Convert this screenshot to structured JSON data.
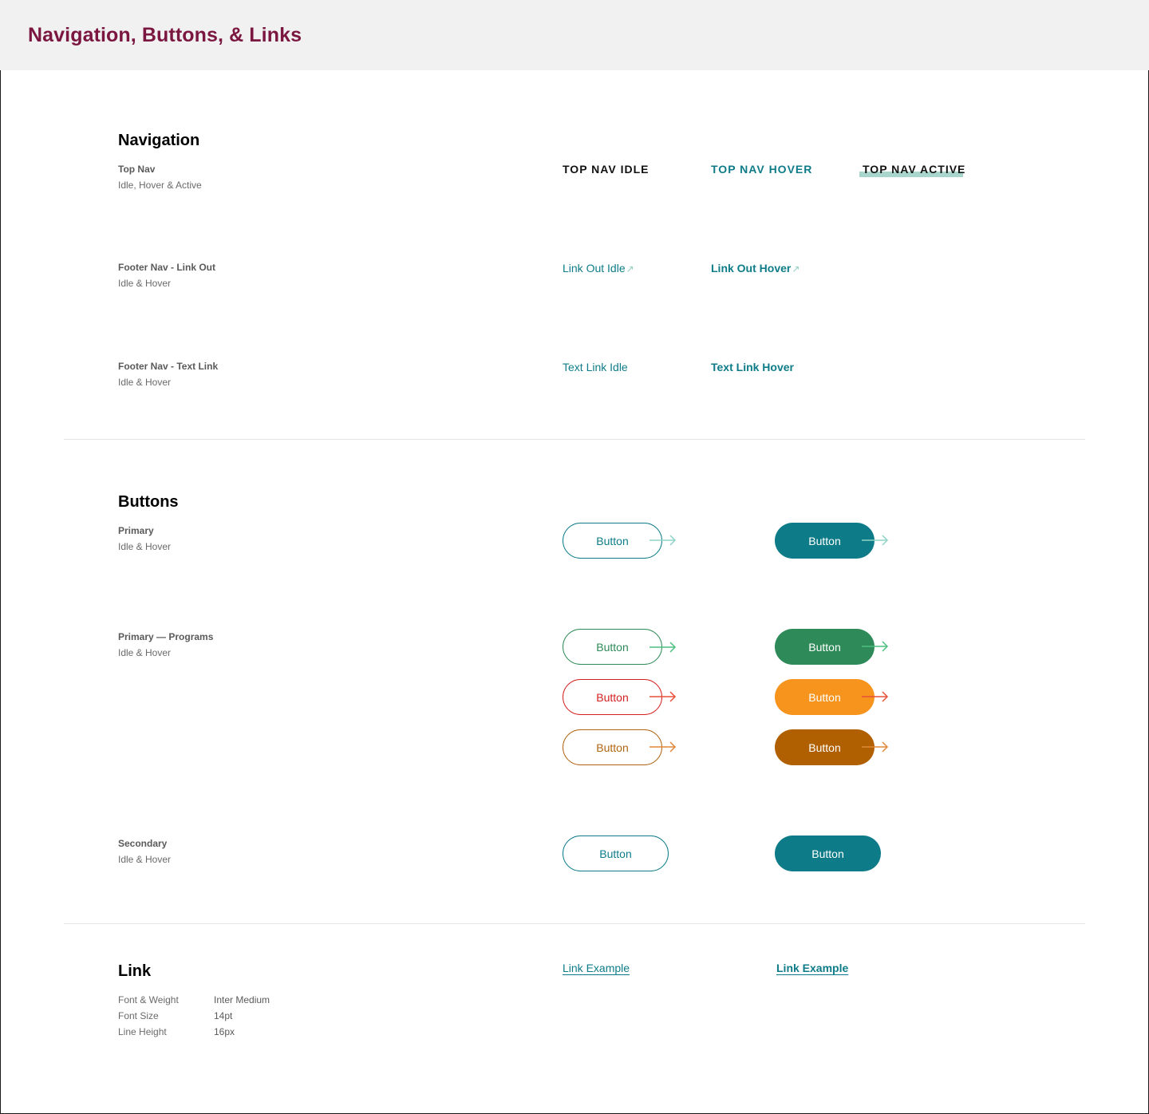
{
  "header": {
    "title": "Navigation, Buttons, & Links"
  },
  "navigation": {
    "title": "Navigation",
    "top_nav": {
      "label": "Top Nav",
      "sub": "Idle, Hover & Active",
      "idle": "TOP NAV IDLE",
      "hover": "TOP NAV HOVER",
      "active": "TOP NAV ACTIVE"
    },
    "footer_link_out": {
      "label": "Footer Nav - Link Out",
      "sub": "Idle & Hover",
      "idle": "Link Out Idle",
      "hover": "Link Out Hover",
      "arrow": "↗"
    },
    "footer_text_link": {
      "label": "Footer Nav - Text Link",
      "sub": "Idle & Hover",
      "idle": "Text Link Idle",
      "hover": "Text Link Hover"
    }
  },
  "buttons": {
    "title": "Buttons",
    "primary": {
      "label": "Primary",
      "sub": "Idle & Hover",
      "button_label": "Button",
      "color": "#0e7c88",
      "arrow_idle_color": "#8fd3c6",
      "arrow_hover_color": "#8fd3c6"
    },
    "programs": {
      "label": "Primary — Programs",
      "sub": "Idle & Hover",
      "rows": [
        {
          "button_label": "Button",
          "outline_color": "#2e8a58",
          "fill_color": "#2e8a58",
          "arrow_color": "#4fbf80"
        },
        {
          "button_label": "Button",
          "outline_color": "#d42020",
          "fill_color": "#f7941d",
          "arrow_color": "#e8503a"
        },
        {
          "button_label": "Button",
          "outline_color": "#b06510",
          "fill_color": "#b06000",
          "arrow_color": "#e0883a"
        }
      ]
    },
    "secondary": {
      "label": "Secondary",
      "sub": "Idle & Hover",
      "button_label": "Button",
      "color": "#0e7c88"
    }
  },
  "link": {
    "title": "Link",
    "example_idle": "Link Example",
    "example_hover": "Link Example",
    "specs": [
      {
        "label": "Font & Weight",
        "value": "Inter Medium"
      },
      {
        "label": "Font Size",
        "value": "14pt"
      },
      {
        "label": "Line Height",
        "value": "16px"
      }
    ]
  }
}
